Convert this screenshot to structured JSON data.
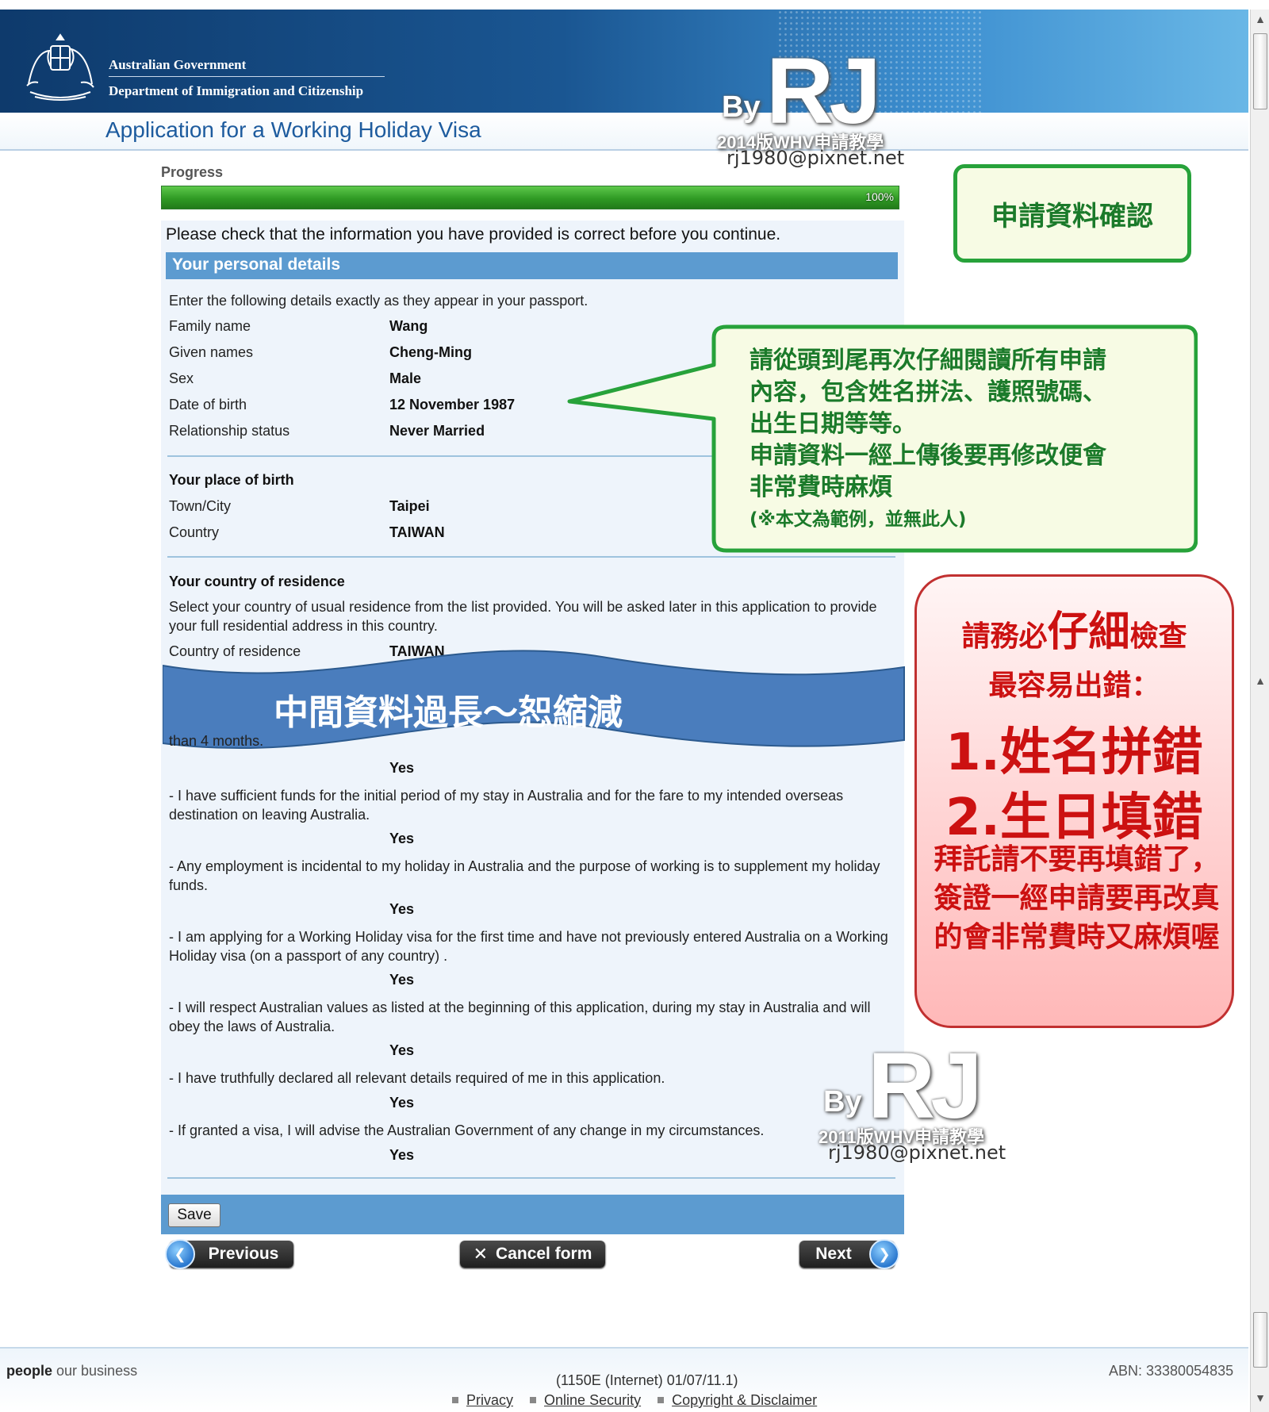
{
  "header": {
    "gov_line1": "Australian Government",
    "gov_line2": "Department of Immigration and Citizenship",
    "app_title": "Application for a Working Holiday Visa"
  },
  "watermark_top": {
    "by": "By",
    "rj": "RJ",
    "line": "2014版WHV申請教學",
    "email": "rj1980@pixnet.net"
  },
  "watermark_bottom": {
    "by": "By",
    "rj": "RJ",
    "line": "2011版WHV申請教學",
    "email": "rj1980@pixnet.net"
  },
  "progress": {
    "label": "Progress",
    "percent_text": "100%",
    "fraction": 1.0,
    "color": "#2f9a24"
  },
  "form": {
    "intro": "Please check that the information you have provided is correct before you continue.",
    "section_title": "Your personal details",
    "passport_note": "Enter the following details exactly as they appear in your passport.",
    "personal": [
      {
        "label": "Family name",
        "value": "Wang"
      },
      {
        "label": "Given names",
        "value": "Cheng-Ming"
      },
      {
        "label": "Sex",
        "value": "Male"
      },
      {
        "label": "Date of birth",
        "value": "12 November 1987"
      },
      {
        "label": "Relationship status",
        "value": "Never Married"
      }
    ],
    "birth_heading": "Your place of birth",
    "birth": [
      {
        "label": "Town/City",
        "value": "Taipei"
      },
      {
        "label": "Country",
        "value": "TAIWAN"
      }
    ],
    "residence_heading": "Your country of residence",
    "residence_note": "Select your country of usual residence from the list provided. You will be asked later in this application to provide your full residential address in this country.",
    "residence_label": "Country of residence",
    "residence_value": "TAIWAN",
    "partial_text": "than 4 months.",
    "declarations": [
      {
        "text": "",
        "answer": "Yes"
      },
      {
        "text": "- I have sufficient funds for the initial period of my stay in Australia and for the fare to my intended overseas destination on leaving Australia.",
        "answer": "Yes"
      },
      {
        "text": "- Any employment is incidental to my holiday in Australia and the purpose of working is to supplement my holiday funds.",
        "answer": "Yes"
      },
      {
        "text": "- I am applying for a Working Holiday visa for the first time and have not previously entered Australia on a Working Holiday visa (on a passport of any country) .",
        "answer": "Yes"
      },
      {
        "text": "- I will respect Australian values as listed at the beginning of this application, during my stay in Australia and will obey the laws of Australia.",
        "answer": "Yes"
      },
      {
        "text": "- I have truthfully declared all relevant details required of me in this application.",
        "answer": "Yes"
      },
      {
        "text": "- If granted a visa, I will advise the Australian Government of any change in my circumstances.",
        "answer": "Yes"
      }
    ],
    "save_label": "Save",
    "previous_label": "Previous",
    "cancel_label": "Cancel form",
    "next_label": "Next"
  },
  "annotations": {
    "confirm_box": "申請資料確認",
    "callout_lines": [
      "請從頭到尾再次仔細閱讀所有申請",
      "內容，包含姓名拼法、護照號碼、",
      "出生日期等等。",
      "申請資料一經上傳後要再修改便會",
      "非常費時麻煩"
    ],
    "callout_small": "(※本文為範例，並無此人)",
    "ribbon": "中間資料過長～恕縮減",
    "warn_line1_pre": "請務必",
    "warn_line1_big": "仔細",
    "warn_line1_post": "檢查",
    "warn_line2": "最容易出錯：",
    "warn_line3": "1.姓名拼錯",
    "warn_line4": "2.生日填錯",
    "warn_line5": "拜託請不要再填錯了，簽證一經申請要再改真的會非常費時又麻煩喔"
  },
  "footer": {
    "tagline_bold": "people",
    "tagline_rest": " our business",
    "abn": "ABN: 33380054835",
    "build": "(1150E (Internet) 01/07/11.1)",
    "links": [
      "Privacy",
      "Online Security",
      "Copyright & Disclaimer"
    ]
  }
}
